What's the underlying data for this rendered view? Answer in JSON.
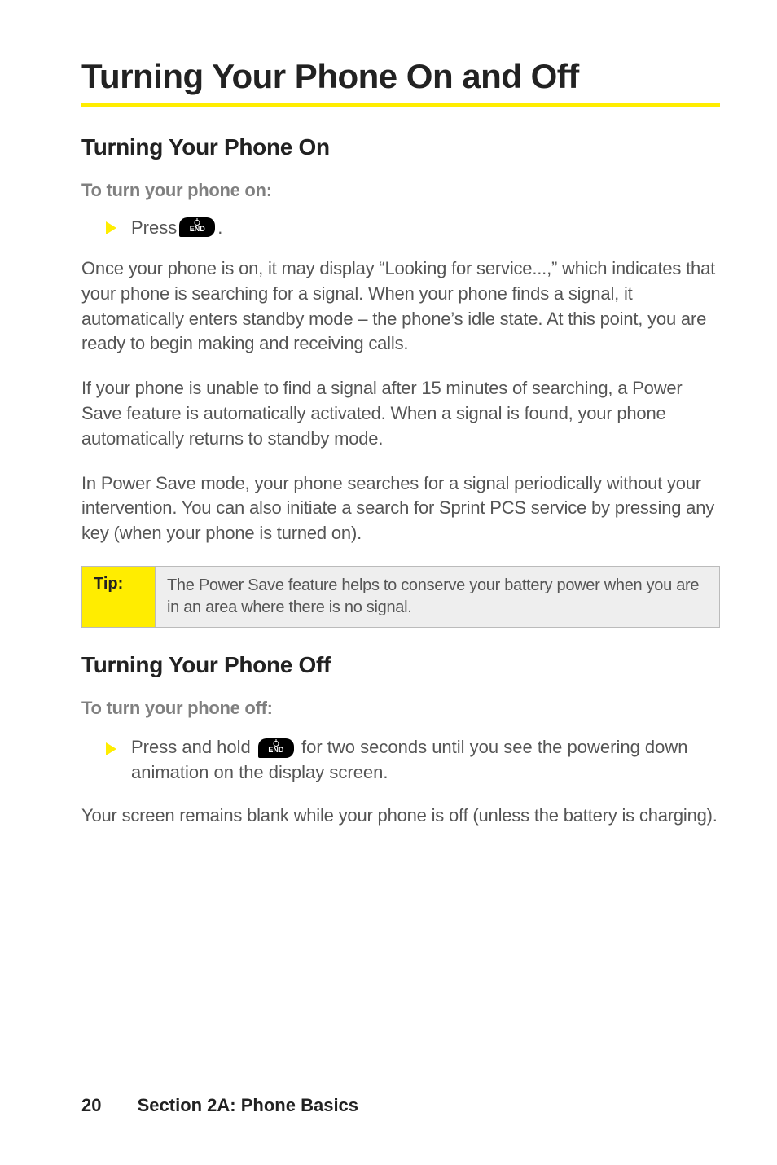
{
  "title": "Turning Your Phone On and Off",
  "sectionOn": {
    "heading": "Turning Your Phone On",
    "lead": "To turn your phone on:",
    "bullet_prefix": "Press ",
    "bullet_suffix": ".",
    "key_label": "END",
    "para1": "Once your phone is on, it may display “Looking for service...,” which indicates that your phone is searching for a signal. When your phone finds a signal, it automatically enters standby mode – the phone’s idle state. At this point, you are ready to begin making and receiving calls.",
    "para2": "If your phone is unable to find a signal after 15 minutes of searching, a Power Save feature is automatically activated. When a signal is found, your phone automatically returns to standby mode.",
    "para3": "In Power Save mode, your phone searches for a signal periodically without your intervention. You can also initiate a search for Sprint PCS service by pressing any key (when your phone is turned on)."
  },
  "tip": {
    "label": "Tip:",
    "body": "The Power Save feature helps to conserve your battery power when you are in an area where there is no signal."
  },
  "sectionOff": {
    "heading": "Turning Your Phone Off",
    "lead": "To turn your phone off:",
    "bullet_prefix": "Press and hold ",
    "bullet_suffix": " for two seconds until you see the powering down animation on the display screen.",
    "key_label": "END",
    "para1": "Your screen remains blank while your phone is off (unless the battery is charging)."
  },
  "footer": {
    "page": "20",
    "section": "Section 2A: Phone Basics"
  }
}
